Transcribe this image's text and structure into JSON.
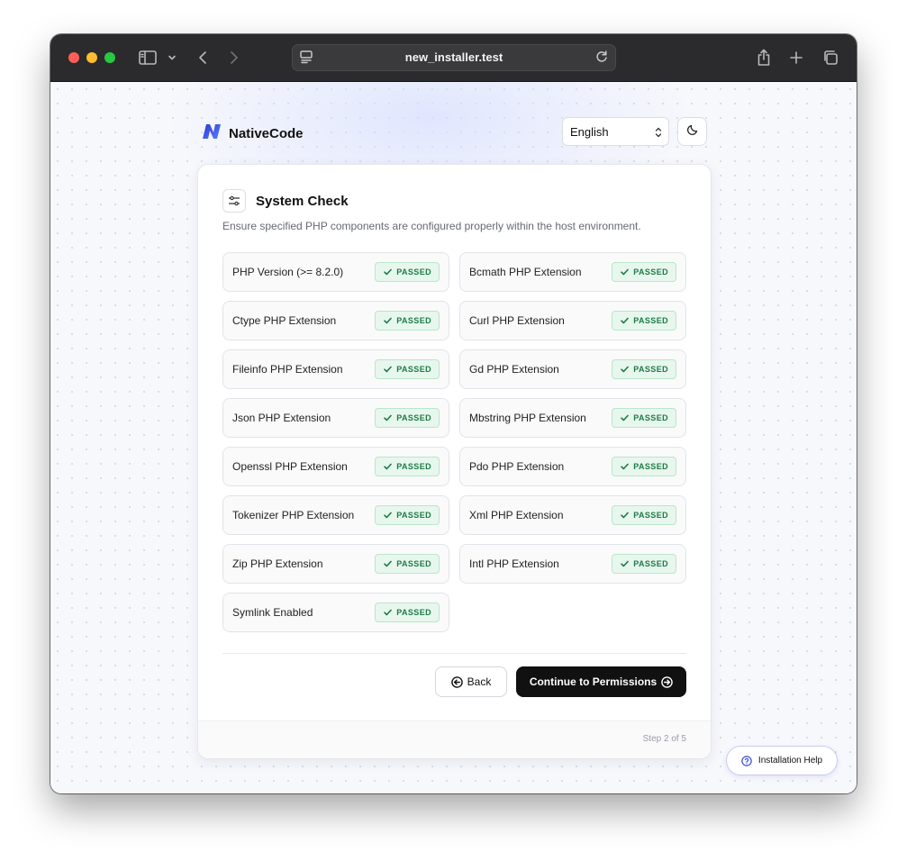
{
  "browser": {
    "url": "new_installer.test"
  },
  "header": {
    "brand_name": "NativeCode",
    "language": "English"
  },
  "card": {
    "title": "System Check",
    "description": "Ensure specified PHP components are configured properly within the host environment.",
    "checks": [
      {
        "label": "PHP Version (>= 8.2.0)",
        "status": "PASSED"
      },
      {
        "label": "Bcmath PHP Extension",
        "status": "PASSED"
      },
      {
        "label": "Ctype PHP Extension",
        "status": "PASSED"
      },
      {
        "label": "Curl PHP Extension",
        "status": "PASSED"
      },
      {
        "label": "Fileinfo PHP Extension",
        "status": "PASSED"
      },
      {
        "label": "Gd PHP Extension",
        "status": "PASSED"
      },
      {
        "label": "Json PHP Extension",
        "status": "PASSED"
      },
      {
        "label": "Mbstring PHP Extension",
        "status": "PASSED"
      },
      {
        "label": "Openssl PHP Extension",
        "status": "PASSED"
      },
      {
        "label": "Pdo PHP Extension",
        "status": "PASSED"
      },
      {
        "label": "Tokenizer PHP Extension",
        "status": "PASSED"
      },
      {
        "label": "Xml PHP Extension",
        "status": "PASSED"
      },
      {
        "label": "Zip PHP Extension",
        "status": "PASSED"
      },
      {
        "label": "Intl PHP Extension",
        "status": "PASSED"
      },
      {
        "label": "Symlink Enabled",
        "status": "PASSED"
      }
    ],
    "back_label": "Back",
    "continue_label": "Continue to Permissions",
    "step_text": "Step 2 of 5"
  },
  "help": {
    "label": "Installation Help"
  },
  "colors": {
    "accent": "#111111",
    "passed_text": "#1f7a45",
    "passed_bg": "#e7f7ee",
    "brand": "#3b4bd6"
  },
  "icons": {
    "brand_logo": "native-code-logo-icon",
    "theme": "moon-icon",
    "card": "sliders-icon",
    "check": "check-icon",
    "back": "arrow-left-circle-icon",
    "next": "arrow-right-circle-icon",
    "help": "question-circle-icon"
  }
}
